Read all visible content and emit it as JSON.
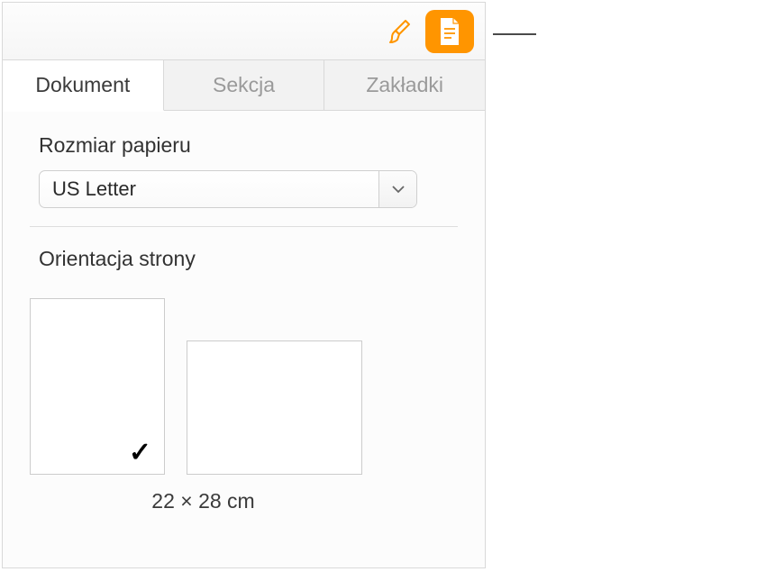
{
  "toolbar": {
    "brush_icon": "paintbrush-icon",
    "doc_icon": "document-icon"
  },
  "tabs": {
    "document": "Dokument",
    "section": "Sekcja",
    "bookmarks": "Zakładki"
  },
  "paper_size": {
    "label": "Rozmiar papieru",
    "value": "US Letter"
  },
  "orientation": {
    "label": "Orientacja strony",
    "dimensions": "22 × 28 cm"
  }
}
